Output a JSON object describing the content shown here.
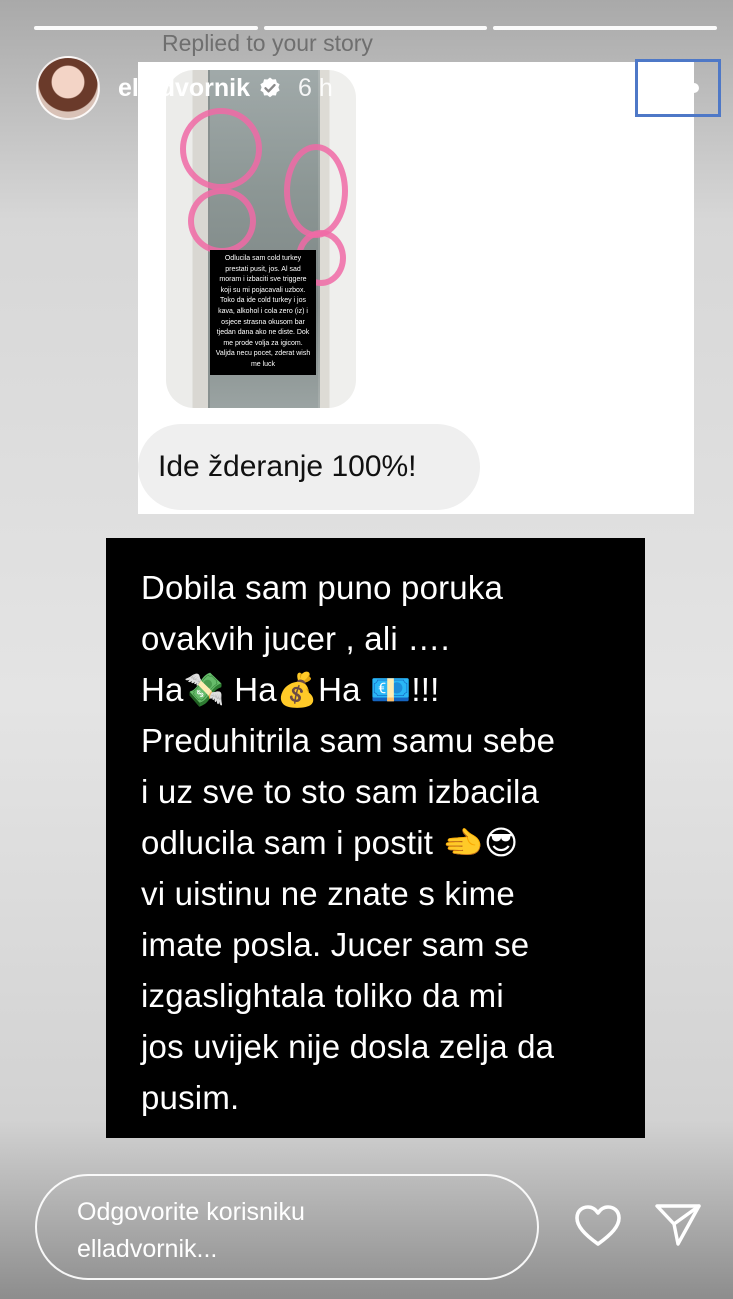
{
  "story": {
    "progress_segments": 3,
    "username": "elladvornik",
    "time": "6 h",
    "replied_label": "Replied to your story"
  },
  "reply_card": {
    "story_thumbnail_text": "Odlucila sam cold turkey prestati pusit, jos. Al sad moram i izbaciti sve triggere koji su mi pojacavali uzbox. Toko da ide cold turkey i jos kava, alkohol i cola zero (iz) i osjece strasna okusom bar tjedan dana ako ne diste. Dok me prode volja za igicom. Valjda necu pocet, zderat wish me luck",
    "bubble_text": "Ide žderanje 100%!"
  },
  "story_text": "Dobila sam puno poruka\novakvih jucer , ali ….\nHa💸 Ha💰Ha 💶!!!\nPreduhitrila sam samu sebe\ni uz sve to sto sam izbacila\nodlucila sam i postit 🫲😎\nvi uistinu ne znate s kime\nimate posla. Jucer sam se\nizgaslightala toliko da mi\njos uvijek nije dosla zelja da\npusim.",
  "reply_bar": {
    "placeholder_line1": "Odgovorite korisniku",
    "placeholder_line2": "elladvornik..."
  },
  "icons": {
    "verified": "verified-badge-icon",
    "play": "play-icon",
    "more": "more-options-icon",
    "like": "heart-icon",
    "send": "send-icon"
  }
}
